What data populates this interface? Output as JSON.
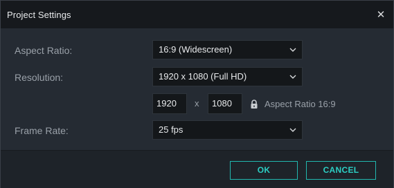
{
  "dialog": {
    "title": "Project Settings",
    "close_glyph": "✕"
  },
  "fields": {
    "aspect_ratio": {
      "label": "Aspect Ratio:",
      "value": "16:9 (Widescreen)"
    },
    "resolution": {
      "label": "Resolution:",
      "value": "1920 x 1080 (Full HD)",
      "width": "1920",
      "times": "x",
      "height": "1080",
      "lock_icon": "lock-icon",
      "ratio_text": "Aspect Ratio 16:9"
    },
    "frame_rate": {
      "label": "Frame Rate:",
      "value": "25 fps"
    }
  },
  "buttons": {
    "ok": "OK",
    "cancel": "CANCEL"
  },
  "colors": {
    "accent": "#21b9b0",
    "title_bar": "#16191d",
    "body": "#252b33",
    "input_bg": "#14171a",
    "label": "#9aa1a9",
    "text": "#e8eaec"
  }
}
